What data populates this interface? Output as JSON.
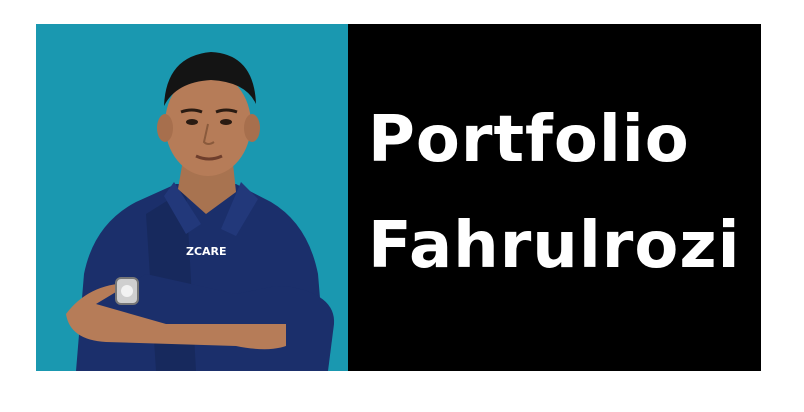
{
  "banner": {
    "title_line1": "Portfolio",
    "title_line2": "Fahrulrozi",
    "photo_panel_color": "#1a98b0",
    "text_panel_color": "#000000",
    "text_color": "#ffffff"
  },
  "photo": {
    "shirt_logo": "ZCARE"
  }
}
